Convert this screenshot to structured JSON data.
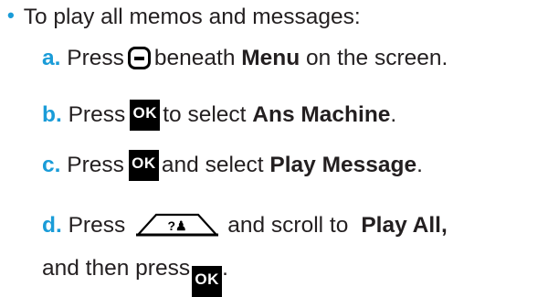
{
  "intro": {
    "bullet": "•",
    "text": "To play all memos and messages:"
  },
  "steps": [
    {
      "letter": "a.",
      "before": "Press",
      "icon": "menu-softkey-icon",
      "middle": "beneath",
      "bold": "Menu",
      "after": "on the screen."
    },
    {
      "letter": "b.",
      "before": "Press",
      "icon_label": "OK",
      "middle": "to select",
      "bold": "Ans Machine",
      "after": "."
    },
    {
      "letter": "c.",
      "before": "Press",
      "icon_label": "OK",
      "middle": "and select",
      "bold": "Play Message",
      "after": "."
    },
    {
      "letter": "d.",
      "before": "Press",
      "icon": "directory-nav-key-icon",
      "middle": "and scroll to",
      "bold": "Play All,",
      "line2_text": "and then press",
      "icon2_label": "OK",
      "after": "."
    }
  ],
  "colors": {
    "accent": "#1a9cd8",
    "text": "#231f20",
    "key": "#000000"
  }
}
